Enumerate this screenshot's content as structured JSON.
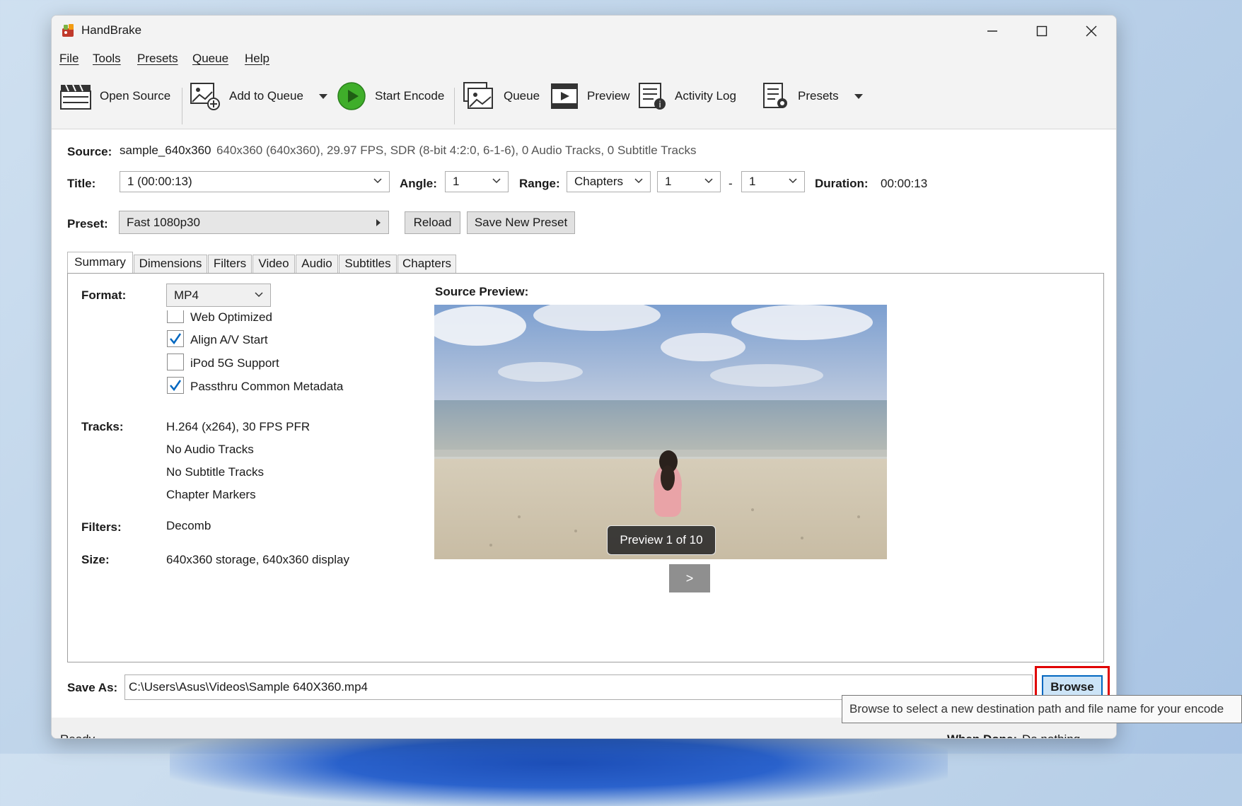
{
  "window": {
    "title": "HandBrake"
  },
  "menu": [
    "File",
    "Tools",
    "Presets",
    "Queue",
    "Help"
  ],
  "toolbar": {
    "open_source": "Open Source",
    "add_to_queue": "Add to Queue",
    "start_encode": "Start Encode",
    "queue": "Queue",
    "preview": "Preview",
    "activity_log": "Activity Log",
    "presets": "Presets"
  },
  "source": {
    "label": "Source:",
    "name": "sample_640x360",
    "info": "640x360 (640x360), 29.97 FPS, SDR (8-bit 4:2:0, 6-1-6), 0 Audio Tracks, 0 Subtitle Tracks"
  },
  "title_row": {
    "title_label": "Title:",
    "title_value": "1  (00:00:13)",
    "angle_label": "Angle:",
    "angle_value": "1",
    "range_label": "Range:",
    "range_mode": "Chapters",
    "range_start": "1",
    "range_sep": "-",
    "range_end": "1",
    "duration_label": "Duration:",
    "duration_value": "00:00:13"
  },
  "preset_row": {
    "label": "Preset:",
    "value": "Fast 1080p30",
    "reload": "Reload",
    "save_new": "Save New Preset"
  },
  "tabs": [
    "Summary",
    "Dimensions",
    "Filters",
    "Video",
    "Audio",
    "Subtitles",
    "Chapters"
  ],
  "summary": {
    "format_label": "Format:",
    "format_value": "MP4",
    "options": [
      {
        "label": "Web Optimized",
        "checked": false
      },
      {
        "label": "Align A/V Start",
        "checked": true
      },
      {
        "label": "iPod 5G Support",
        "checked": false
      },
      {
        "label": "Passthru Common Metadata",
        "checked": true
      }
    ],
    "tracks_label": "Tracks:",
    "tracks": [
      "H.264 (x264), 30 FPS PFR",
      "No Audio Tracks",
      "No Subtitle Tracks",
      "Chapter Markers"
    ],
    "filters_label": "Filters:",
    "filters_value": "Decomb",
    "size_label": "Size:",
    "size_value": "640x360 storage, 640x360 display",
    "preview_label": "Source Preview:",
    "preview_badge": "Preview 1 of 10",
    "next_label": ">"
  },
  "save_as": {
    "label": "Save As:",
    "path": "C:\\Users\\Asus\\Videos\\Sample 640X360.mp4",
    "browse": "Browse"
  },
  "status": {
    "text": "Ready",
    "when_done_label": "When Done:",
    "when_done_value": "Do nothing"
  },
  "tooltip": "Browse to select a new destination path and file name for your encode",
  "colors": {
    "accent": "#0067c0",
    "highlight": "#e00000",
    "play": "#3fae2a"
  }
}
